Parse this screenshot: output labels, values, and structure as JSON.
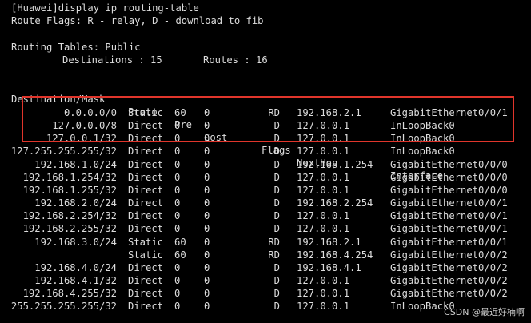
{
  "terminal": {
    "command_line": "[Huawei]display ip routing-table",
    "flags_line": "Route Flags: R - relay, D - download to fib",
    "tables_label": "Routing Tables: Public",
    "destinations_label": "Destinations : 15",
    "routes_label": "Routes : 16",
    "columns": {
      "dest": "Destination/Mask",
      "proto": "Proto",
      "pre": "Pre",
      "cost": "Cost",
      "flags": "Flags",
      "nexthop": "NextHop",
      "interface": "Interface"
    },
    "rows": [
      {
        "dest": "0.0.0.0/0",
        "proto": "Static",
        "pre": "60",
        "cost": "0",
        "flags": "RD",
        "nexthop": "192.168.2.1",
        "interface": "GigabitEthernet0/0/1"
      },
      {
        "dest": "127.0.0.0/8",
        "proto": "Direct",
        "pre": "0",
        "cost": "0",
        "flags": "D",
        "nexthop": "127.0.0.1",
        "interface": "InLoopBack0"
      },
      {
        "dest": "127.0.0.1/32",
        "proto": "Direct",
        "pre": "0",
        "cost": "0",
        "flags": "D",
        "nexthop": "127.0.0.1",
        "interface": "InLoopBack0"
      },
      {
        "dest": "127.255.255.255/32",
        "proto": "Direct",
        "pre": "0",
        "cost": "0",
        "flags": "D",
        "nexthop": "127.0.0.1",
        "interface": "InLoopBack0"
      },
      {
        "dest": "192.168.1.0/24",
        "proto": "Direct",
        "pre": "0",
        "cost": "0",
        "flags": "D",
        "nexthop": "192.168.1.254",
        "interface": "GigabitEthernet0/0/0"
      },
      {
        "dest": "192.168.1.254/32",
        "proto": "Direct",
        "pre": "0",
        "cost": "0",
        "flags": "D",
        "nexthop": "127.0.0.1",
        "interface": "GigabitEthernet0/0/0"
      },
      {
        "dest": "192.168.1.255/32",
        "proto": "Direct",
        "pre": "0",
        "cost": "0",
        "flags": "D",
        "nexthop": "127.0.0.1",
        "interface": "GigabitEthernet0/0/0"
      },
      {
        "dest": "192.168.2.0/24",
        "proto": "Direct",
        "pre": "0",
        "cost": "0",
        "flags": "D",
        "nexthop": "192.168.2.254",
        "interface": "GigabitEthernet0/0/1"
      },
      {
        "dest": "192.168.2.254/32",
        "proto": "Direct",
        "pre": "0",
        "cost": "0",
        "flags": "D",
        "nexthop": "127.0.0.1",
        "interface": "GigabitEthernet0/0/1"
      },
      {
        "dest": "192.168.2.255/32",
        "proto": "Direct",
        "pre": "0",
        "cost": "0",
        "flags": "D",
        "nexthop": "127.0.0.1",
        "interface": "GigabitEthernet0/0/1"
      },
      {
        "dest": "192.168.3.0/24",
        "proto": "Static",
        "pre": "60",
        "cost": "0",
        "flags": "RD",
        "nexthop": "192.168.2.1",
        "interface": "GigabitEthernet0/0/1"
      },
      {
        "dest": "",
        "proto": "Static",
        "pre": "60",
        "cost": "0",
        "flags": "RD",
        "nexthop": "192.168.4.254",
        "interface": "GigabitEthernet0/0/2"
      },
      {
        "dest": "192.168.4.0/24",
        "proto": "Direct",
        "pre": "0",
        "cost": "0",
        "flags": "D",
        "nexthop": "192.168.4.1",
        "interface": "GigabitEthernet0/0/2"
      },
      {
        "dest": "192.168.4.1/32",
        "proto": "Direct",
        "pre": "0",
        "cost": "0",
        "flags": "D",
        "nexthop": "127.0.0.1",
        "interface": "GigabitEthernet0/0/2"
      },
      {
        "dest": "192.168.4.255/32",
        "proto": "Direct",
        "pre": "0",
        "cost": "0",
        "flags": "D",
        "nexthop": "127.0.0.1",
        "interface": "GigabitEthernet0/0/2"
      },
      {
        "dest": "255.255.255.255/32",
        "proto": "Direct",
        "pre": "0",
        "cost": "0",
        "flags": "D",
        "nexthop": "127.0.0.1",
        "interface": "InLoopBack0"
      }
    ]
  },
  "watermark": "CSDN @最近好楠啊",
  "colors": {
    "background": "#000000",
    "text": "#dcdcdc",
    "highlight_border": "#e0352b"
  }
}
